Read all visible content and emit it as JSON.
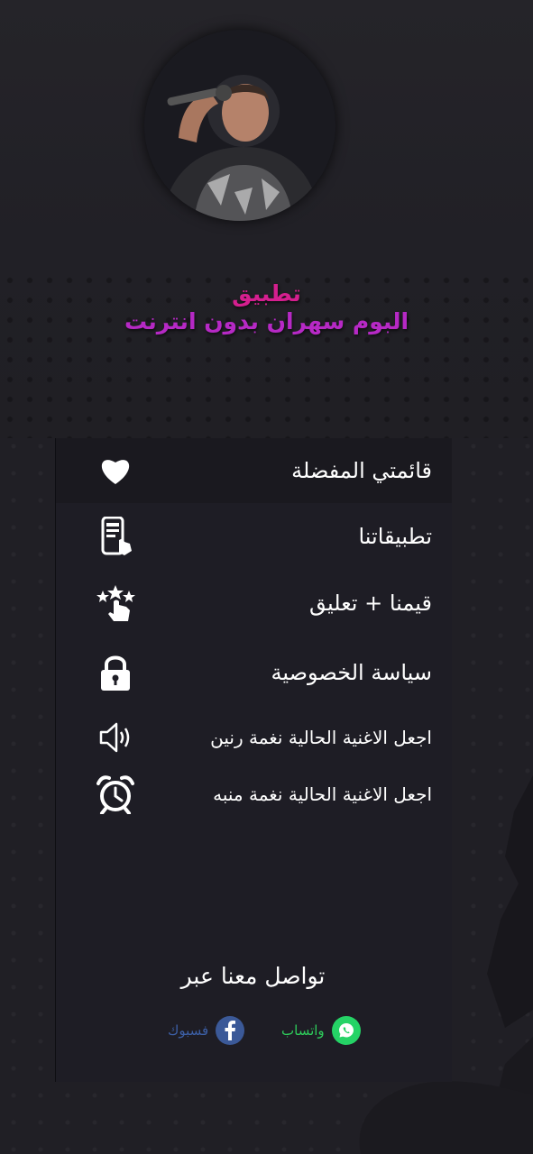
{
  "header": {
    "app_label": "تطبيق",
    "album_title": "البوم سهران بدون انترنت"
  },
  "menu": {
    "items": [
      {
        "label": "قائمتي المفضلة",
        "icon": "heart-icon"
      },
      {
        "label": "تطبيقاتنا",
        "icon": "phone-apps-icon"
      },
      {
        "label": "قيمنا + تعليق",
        "icon": "rate-stars-icon"
      },
      {
        "label": "سياسة الخصوصية",
        "icon": "lock-icon"
      },
      {
        "label": "اجعل الاغنية الحالية نغمة رنين",
        "icon": "speaker-icon"
      },
      {
        "label": "اجعل الاغنية الحالية نغمة منبه",
        "icon": "alarm-clock-icon"
      }
    ]
  },
  "contact": {
    "title": "تواصل معنا عبر",
    "whatsapp_label": "واتساب",
    "facebook_label": "فسبوك"
  },
  "colors": {
    "background": "#201f25",
    "drawer": "#1e1d25",
    "title_pink": "#d51f8f",
    "title_purple": "#b629c5",
    "whatsapp": "#25d366",
    "facebook": "#3b5998"
  }
}
